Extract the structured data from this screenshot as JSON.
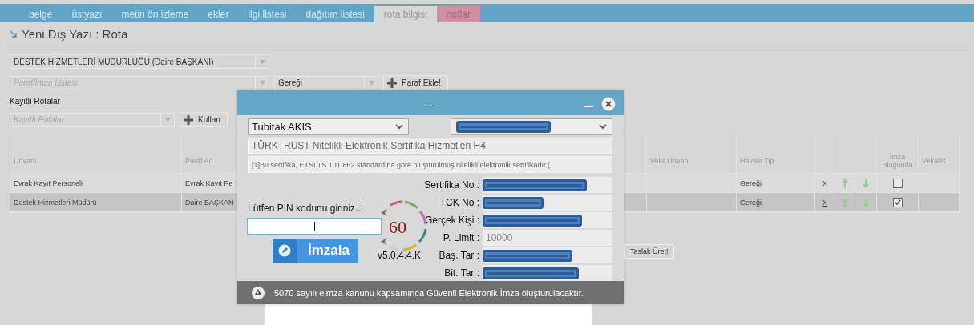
{
  "tabs": [
    {
      "label": "belge",
      "selected": false,
      "highlighted": false
    },
    {
      "label": "üstyazı",
      "selected": false,
      "highlighted": false
    },
    {
      "label": "metin ön izleme",
      "selected": false,
      "highlighted": false
    },
    {
      "label": "ekler",
      "selected": false,
      "highlighted": false
    },
    {
      "label": "ilgi listesi",
      "selected": false,
      "highlighted": false
    },
    {
      "label": "dağıtım listesi",
      "selected": false,
      "highlighted": false
    },
    {
      "label": "rota bilgisi",
      "selected": true,
      "highlighted": false
    },
    {
      "label": "notlar",
      "selected": false,
      "highlighted": true
    }
  ],
  "page_title": "Yeni Dış Yazı : Rota",
  "unit_select": {
    "value": "DESTEK HİZMETLERİ MÜDÜRLÜĞÜ (Daire BAŞKANI)"
  },
  "paraf_select": {
    "placeholder": "Paraf/İmza Listesi"
  },
  "havale_select": {
    "value": "Gereği"
  },
  "paraf_add_button": "Paraf Ekle!",
  "saved_routes_label": "Kayıtlı Rotalar",
  "saved_routes_select": {
    "placeholder": "Kayıtlı Rotalar"
  },
  "use_button": "Kullan",
  "table": {
    "columns": [
      "Unvanı",
      "Paraf Ad",
      "Vekil Unvan",
      "Havale Tip",
      "İmza Bloğunda",
      "Vekalet"
    ],
    "rows": [
      {
        "selected": false,
        "unvan": "Evrak Kayıt Personeli",
        "paraf_ad": "Evrak Kayıt Pe",
        "havale_tip": "Gereği",
        "remove": "X",
        "imza_blogunda": false
      },
      {
        "selected": true,
        "unvan": "Destek Hizmetleri Müdürü",
        "paraf_ad": "Daire BAŞKAN",
        "havale_tip": "Gereği",
        "remove": "X",
        "imza_blogunda": true
      }
    ]
  },
  "draft_button": "Taslak Üret!",
  "dialog": {
    "title": "......",
    "device_select": {
      "value": "Tubitak AKIS"
    },
    "issuer": "TÜRKTRUST Nitelikli Elektronik Sertifika Hizmetleri H4",
    "policy": "[1]Bu sertifika, ETSI TS 101 862 standardına göre oluşturulmuş nitelikli elektronik sertifikadır.(",
    "fields": [
      {
        "label": "Sertifika No :",
        "redacted": true
      },
      {
        "label": "TCK No :",
        "redacted": true
      },
      {
        "label": "Gerçek Kişi :",
        "redacted": true
      },
      {
        "label": "P. Limit :",
        "redacted": false,
        "value": "10000"
      },
      {
        "label": "Baş. Tar :",
        "redacted": true
      },
      {
        "label": "Bit. Tar :",
        "redacted": true
      }
    ],
    "pin_prompt": "Lütfen PIN kodunu giriniz..!",
    "sign_button": "İmzala",
    "countdown": "60",
    "version": "v5.0.4.4.K",
    "notice": "5070 sayılı elmza kanunu kapsamınca Güvenli Elektronik İmza oluşturulacaktır."
  }
}
